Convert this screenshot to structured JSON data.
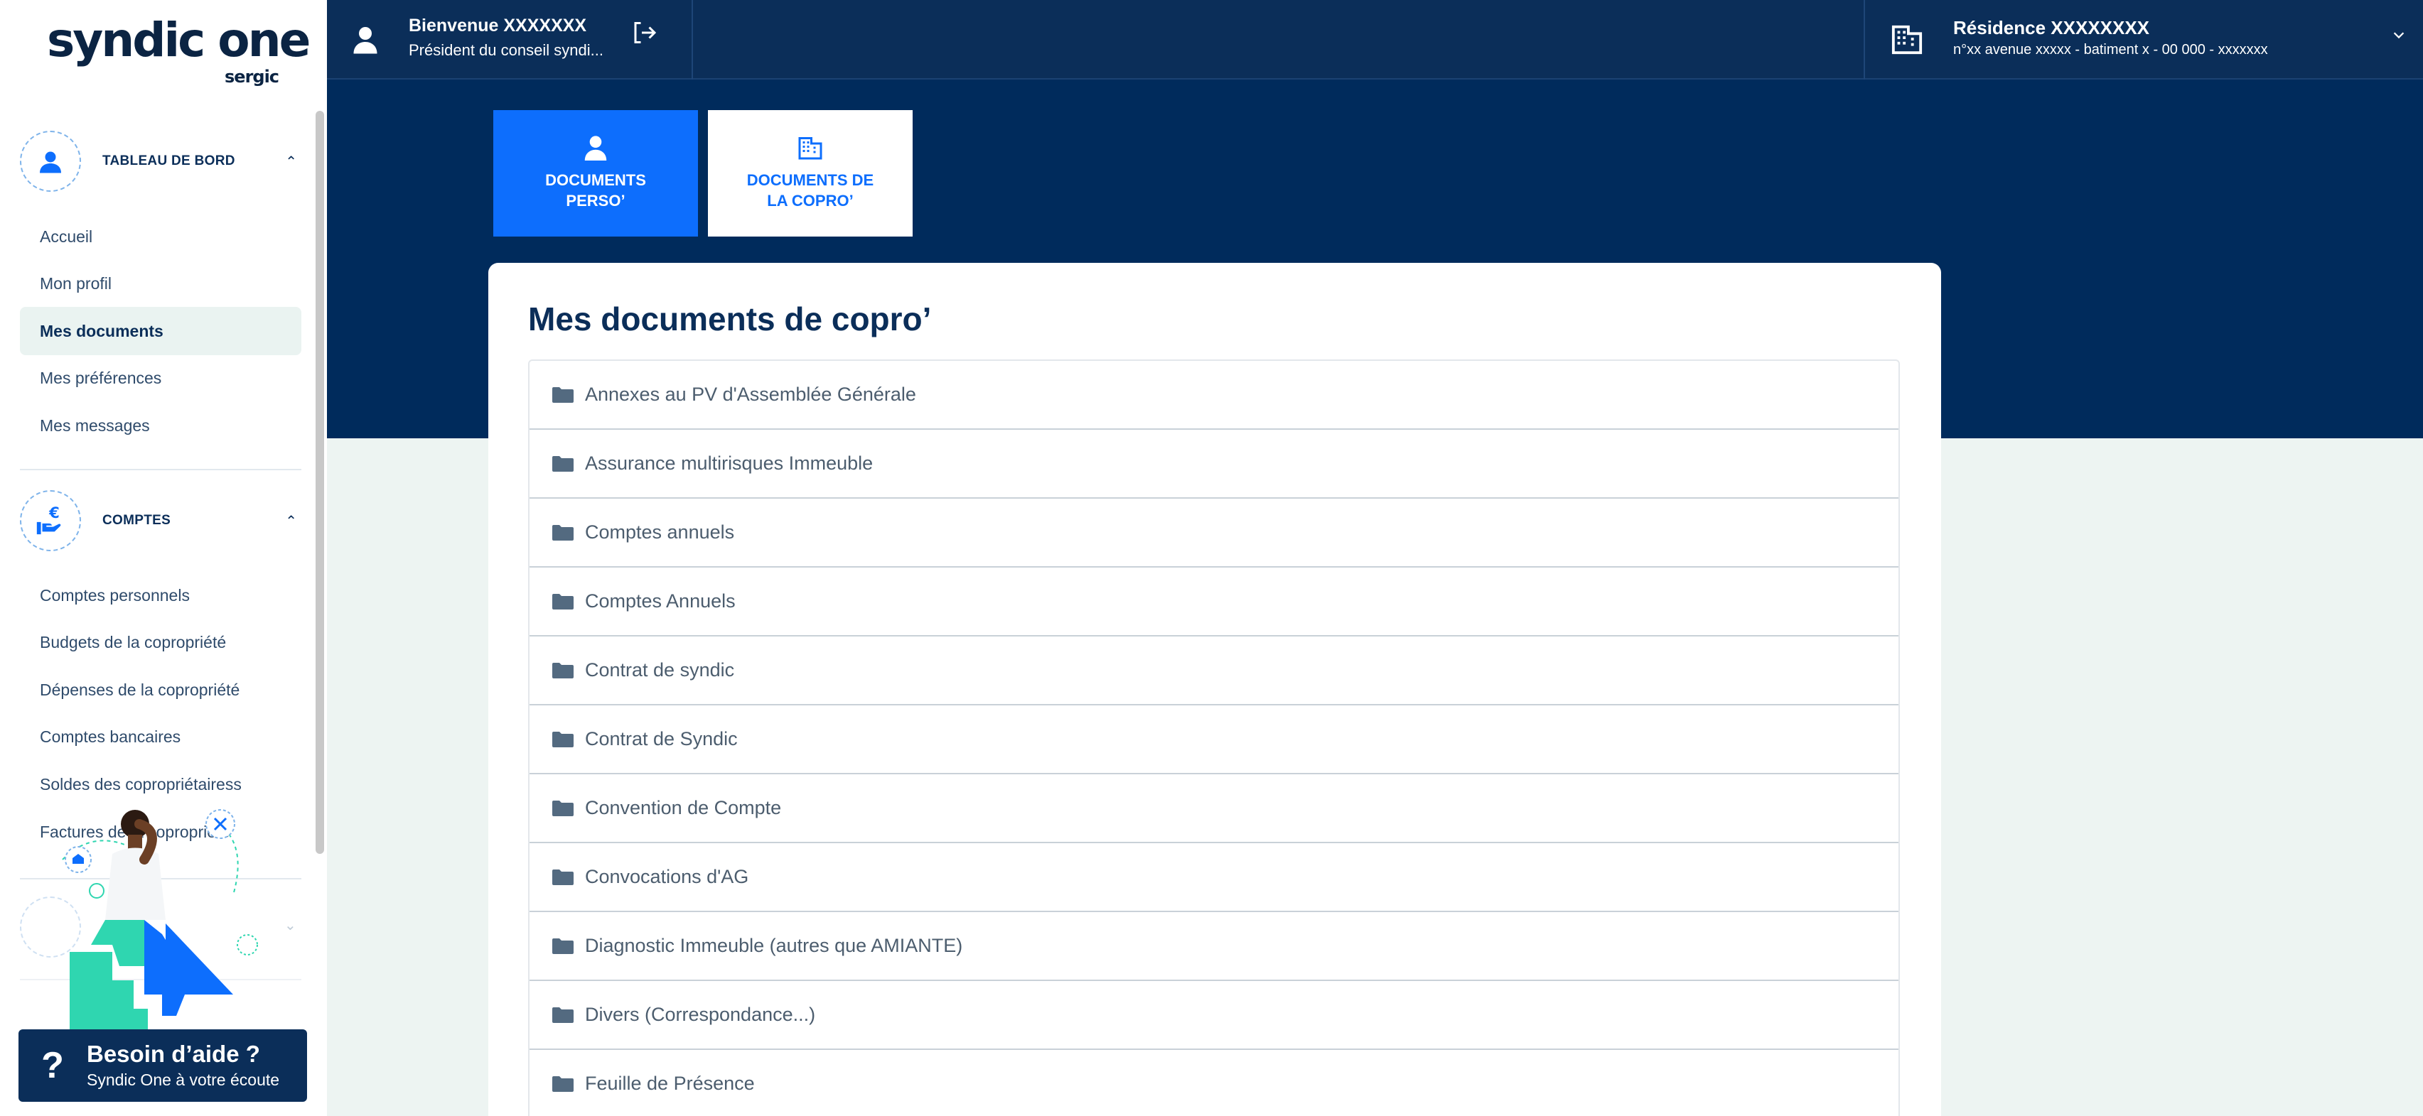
{
  "brand": {
    "logo": "syndic one",
    "logo_sub": "sergic"
  },
  "header": {
    "user_name": "Bienvenue  XXXXXXX",
    "user_role": "Président du conseil syndi...",
    "residence_name": "Résidence XXXXXXXX",
    "residence_address": "n°xx avenue xxxxx - batiment x - 00 000 - xxxxxxx"
  },
  "sidebar": {
    "sections": [
      {
        "title": "TABLEAU DE BORD",
        "icon": "user-icon",
        "items": [
          {
            "label": "Accueil",
            "active": false
          },
          {
            "label": "Mon profil",
            "active": false
          },
          {
            "label": "Mes documents",
            "active": true
          },
          {
            "label": "Mes préférences",
            "active": false
          },
          {
            "label": "Mes messages",
            "active": false
          }
        ]
      },
      {
        "title": "COMPTES",
        "icon": "euro-hand-icon",
        "items": [
          {
            "label": "Comptes personnels"
          },
          {
            "label": "Budgets de la copropriété"
          },
          {
            "label": "Dépenses de la copropriété"
          },
          {
            "label": "Comptes bancaires"
          },
          {
            "label": "Soldes des copropriétairess"
          },
          {
            "label": "Factures de la copropriété"
          }
        ]
      }
    ],
    "help": {
      "title": "Besoin d’aide ?",
      "subtitle": "Syndic One à votre écoute"
    }
  },
  "tabs": [
    {
      "line1": "DOCUMENTS",
      "line2": "PERSO’",
      "icon": "user-icon",
      "active": true
    },
    {
      "line1": "DOCUMENTS DE",
      "line2": "LA COPRO’",
      "icon": "building-icon",
      "active": false
    }
  ],
  "main": {
    "title": "Mes documents de copro’",
    "folders": [
      "Annexes au PV d'Assemblée Générale",
      "Assurance multirisques Immeuble",
      "Comptes annuels",
      "Comptes Annuels",
      "Contrat de syndic",
      "Contrat de Syndic",
      "Convention de Compte",
      "Convocations d'AG",
      "Diagnostic Immeuble (autres que AMIANTE)",
      "Divers (Correspondance...)",
      "Feuille de Présence"
    ]
  },
  "colors": {
    "navy": "#0b2e59",
    "banner": "#002b5c",
    "accent": "#0d6efd",
    "background": "#edf4f2"
  }
}
